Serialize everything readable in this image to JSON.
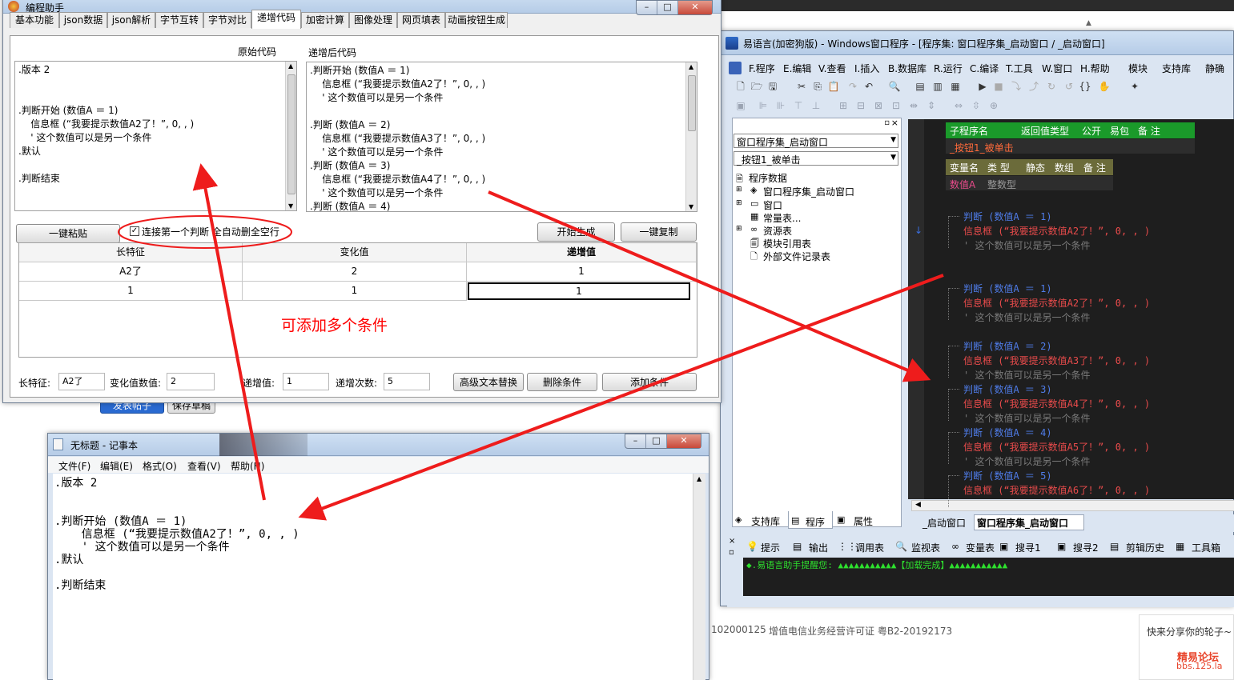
{
  "background": {
    "toolbar_buttons": [
      "发表帖子",
      "保存草稿"
    ],
    "footer_left": "102000125",
    "footer_license": "增值电信业务经营许可证 粤B2-20192173",
    "share_text": "快来分享你的轮子~",
    "forum_name": "精易论坛",
    "forum_url": "bbs.125.la"
  },
  "helper": {
    "title": "编程助手",
    "tabs": [
      "基本功能",
      "json数据",
      "json解析",
      "字节互转",
      "字节对比",
      "递增代码",
      "加密计算",
      "图像处理",
      "网页填表",
      "动画按钮生成"
    ],
    "active_tab": 5,
    "original_label": "原始代码",
    "result_label": "递增后代码",
    "original_code": ".版本 2\n\n\n.判断开始 (数值A ＝ 1)\n    信息框 (“我要提示数值A2了！”, 0, , )\n    ' 这个数值可以是另一个条件\n.默认\n\n.判断结束",
    "result_code": ".判断开始 (数值A ＝ 1)\n    信息框 (“我要提示数值A2了！”, 0, , )\n    ' 这个数值可以是另一个条件\n\n.判断 (数值A ＝ 2)\n    信息框 (“我要提示数值A3了！”, 0, , )\n    ' 这个数值可以是另一个条件\n.判断 (数值A ＝ 3)\n    信息框 (“我要提示数值A4了！”, 0, , )\n    ' 这个数值可以是另一个条件\n.判断 (数值A ＝ 4)",
    "paste_button": "一键粘贴",
    "checkbox_label": "连接第一个判断 全自动删全空行",
    "generate_button": "开始生成",
    "copy_button": "一键复制",
    "table": {
      "headers": [
        "长特征",
        "变化值",
        "递增值"
      ],
      "rows": [
        [
          "A2了",
          "2",
          "1"
        ],
        [
          "1",
          "1",
          "1"
        ]
      ]
    },
    "annotation": "可添加多个条件",
    "fields": {
      "feature_label": "长特征:",
      "feature_value": "A2了",
      "change_label": "变化值数值:",
      "change_value": "2",
      "inc_label": "递增值:",
      "inc_value": "1",
      "count_label": "递增次数:",
      "count_value": "5"
    },
    "advanced_button": "高级文本替换",
    "delete_button": "删除条件",
    "add_button": "添加条件"
  },
  "notepad": {
    "title": "无标题 - 记事本",
    "menu": [
      "文件(F)",
      "编辑(E)",
      "格式(O)",
      "查看(V)",
      "帮助(H)"
    ],
    "content": ".版本 2\n\n\n.判断开始 (数值A ＝ 1)\n    信息框 (“我要提示数值A2了！”, 0, , )\n    ' 这个数值可以是另一个条件\n.默认\n\n.判断结束"
  },
  "ide": {
    "title": "易语言(加密狗版) - Windows窗口程序 - [程序集: 窗口程序集_启动窗口 / _启动窗口]",
    "menu": [
      "F.程序",
      "E.编辑",
      "V.查看",
      "I.插入",
      "B.数据库",
      "R.运行",
      "C.编译",
      "T.工具",
      "W.窗口",
      "H.帮助",
      "模块",
      "支持库",
      "静确"
    ],
    "combo1": "窗口程序集_启动窗口",
    "combo2": "_按钮1_被单击",
    "tree": [
      "程序数据",
      "窗口程序集_启动窗口",
      "窗口",
      "常量表...",
      "资源表",
      "模块引用表",
      "外部文件记录表"
    ],
    "sub_header": [
      "子程序名",
      "返回值类型",
      "公开",
      "易包",
      "备 注"
    ],
    "sub_name": "_按钮1_被单击",
    "var_header": [
      "变量名",
      "类 型",
      "静态",
      "数组",
      "备 注"
    ],
    "var_row": [
      "数值A",
      "整数型"
    ],
    "code_blocks": [
      {
        "cond": "判断 (数值A ＝ 1)",
        "msg": "信息框 (“我要提示数值A2了！”, 0, , )",
        "comment": "' 这个数值可以是另一个条件"
      },
      {
        "cond": "判断 (数值A ＝ 1)",
        "msg": "信息框 (“我要提示数值A2了！”, 0, , )",
        "comment": "' 这个数值可以是另一个条件"
      },
      {
        "cond": "判断 (数值A ＝ 2)",
        "msg": "信息框 (“我要提示数值A3了！”, 0, , )",
        "comment": "' 这个数值可以是另一个条件"
      },
      {
        "cond": "判断 (数值A ＝ 3)",
        "msg": "信息框 (“我要提示数值A4了！”, 0, , )",
        "comment": "' 这个数值可以是另一个条件"
      },
      {
        "cond": "判断 (数值A ＝ 4)",
        "msg": "信息框 (“我要提示数值A5了！”, 0, , )",
        "comment": "' 这个数值可以是另一个条件"
      },
      {
        "cond": "判断 (数值A ＝ 5)",
        "msg": "信息框 (“我要提示数值A6了！”, 0, , )",
        "comment": ""
      }
    ],
    "left_tabs": [
      "支持库",
      "程序",
      "属性"
    ],
    "editor_tabs": [
      "_启动窗口",
      "窗口程序集_启动窗口"
    ],
    "bottom_tabs": [
      "提示",
      "输出",
      "调用表",
      "监视表",
      "变量表",
      "搜寻1",
      "搜寻2",
      "剪辑历史",
      "工具箱"
    ],
    "output": "◆.易语言助手提醒您: ▲▲▲▲▲▲▲▲▲▲▲【加载完成】▲▲▲▲▲▲▲▲▲▲▲"
  },
  "colors": {
    "annotation": "#ff0000",
    "arrow": "#ee1c1c",
    "ide_editor_bg": "#1e1e1e",
    "ide_header_green": "#1a9a2a",
    "ide_header_olive": "#6b6b3a"
  }
}
